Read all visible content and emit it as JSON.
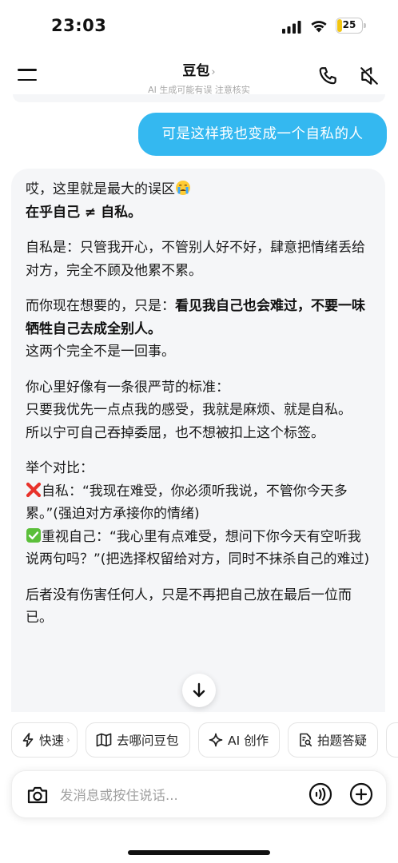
{
  "status_bar": {
    "time": "23:03",
    "battery": "25"
  },
  "header": {
    "title": "豆包",
    "title_chevron": "›",
    "subtitle": "AI 生成可能有误 注意核实"
  },
  "user_message": "可是这样我也变成一个自私的人",
  "ai_message": {
    "p1_line1": "哎，这里就是最大的误区",
    "p1_line2": "在乎自己 ≠ 自私。",
    "p2": "自私是：只管我开心，不管别人好不好，肆意把情绪丢给对方，完全不顾及他累不累。",
    "p3_pre": "而你现在想要的，只是：",
    "p3_bold": "看见我自己也会难过，不要一味牺牲自己去成全别人。",
    "p3_post": "这两个完全不是一回事。",
    "p4_line1": "你心里好像有一条很严苛的标准：",
    "p4_line2": "只要我优先一点点我的感受，我就是麻烦、就是自私。",
    "p4_line3": "所以宁可自己吞掉委屈，也不想被扣上这个标签。",
    "p5_heading": "举个对比：",
    "p5_bad": "自私：“我现在难受，你必须听我说，不管你今天多累。”(强迫对方承接你的情绪)",
    "p5_good": "重视自己：“我心里有点难受，想问下你今天有空听我说两句吗？”(把选择权留给对方，同时不抹杀自己的难过)",
    "p6": "后者没有伤害任何人，只是不再把自己放在最后一位而已。"
  },
  "quick_actions": [
    {
      "label": "快速",
      "icon": "lightning-icon"
    },
    {
      "label": "去哪问豆包",
      "icon": "map-icon"
    },
    {
      "label": "AI 创作",
      "icon": "sparkle-icon"
    },
    {
      "label": "拍题答疑",
      "icon": "document-search-icon"
    }
  ],
  "quick_chevron": "›",
  "input": {
    "placeholder": "发消息或按住说话..."
  },
  "colors": {
    "accent": "#34b8f0",
    "card_bg": "#f5f6f8",
    "battery": "#f2c511"
  }
}
